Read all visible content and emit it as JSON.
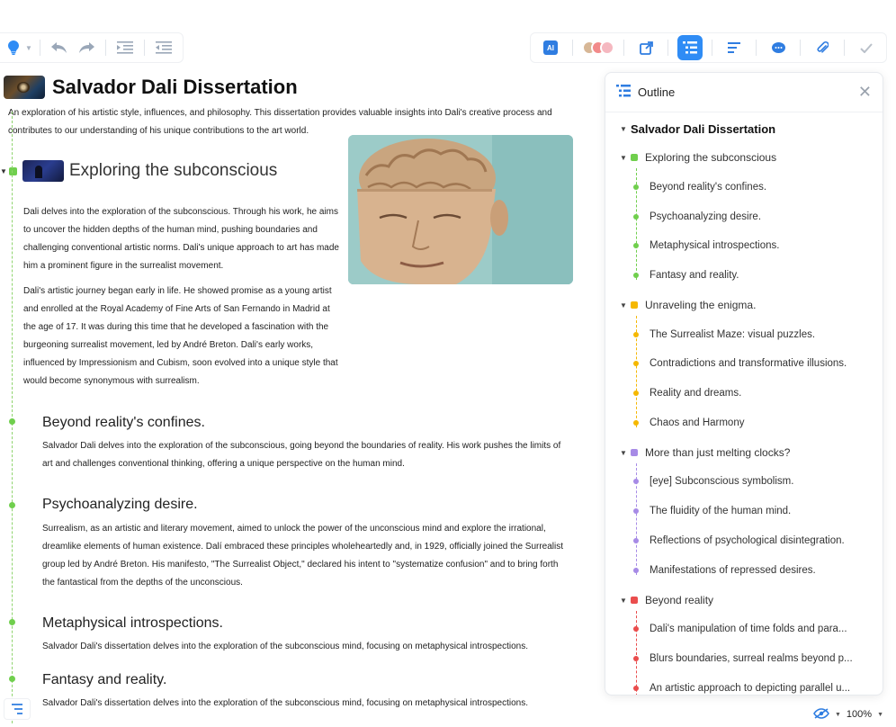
{
  "toolbar_left": {
    "icons": [
      "lightbulb-icon",
      "undo-icon",
      "redo-icon",
      "indent-icon",
      "outdent-icon"
    ]
  },
  "toolbar_right": {
    "ai_label": "AI",
    "icons": [
      "ai-icon",
      "collaborators-avatars",
      "share-icon",
      "outline-icon",
      "text-format-icon",
      "comment-icon",
      "attachment-icon",
      "check-icon"
    ]
  },
  "document": {
    "title": "Salvador Dali Dissertation",
    "description": "An exploration of his artistic style, influences, and philosophy. This dissertation provides valuable insights into Dali's creative process and contributes to our understanding of his unique contributions to the art world.",
    "topic": {
      "title": "Exploring the subconscious",
      "paragraphs": [
        "Dali delves into the exploration of the subconscious. Through his work, he aims to uncover the hidden depths of the human mind, pushing boundaries and challenging conventional artistic norms. Dali's unique approach to art has made him a prominent figure in the surrealist movement.",
        "Dali's artistic journey began early in life. He showed promise as a young artist and enrolled at the Royal Academy of Fine Arts of San Fernando in Madrid at the age of 17. It was during this time that he developed a fascination with the burgeoning surrealist movement, led by André Breton. Dali's early works, influenced by Impressionism and Cubism, soon evolved into a unique style that would become synonymous with surrealism."
      ]
    },
    "subsections": [
      {
        "title": "Beyond reality's confines.",
        "text": "Salvador Dali delves into the exploration of the subconscious, going beyond the boundaries of reality. His work pushes the limits of art and challenges conventional thinking, offering a unique perspective on the human mind."
      },
      {
        "title": "Psychoanalyzing desire.",
        "text": "Surrealism, as an artistic and literary movement, aimed to unlock the power of the unconscious mind and explore the irrational, dreamlike elements of human existence. Dalí embraced these principles wholeheartedly and, in 1929, officially joined the Surrealist group led by André Breton. His manifesto, \"The Surrealist Object,\" declared his intent to \"systematize confusion\" and to bring forth the fantastical from the depths of the unconscious."
      },
      {
        "title": "Metaphysical introspections.",
        "text": "Salvador Dali's dissertation delves into the exploration of the subconscious mind, focusing on metaphysical introspections."
      },
      {
        "title": "Fantasy and reality.",
        "text": "Salvador Dali's dissertation delves into the exploration of the subconscious mind, focusing on metaphysical introspections."
      }
    ]
  },
  "outline": {
    "title": "Outline",
    "root": "Salvador Dali Dissertation",
    "sections": [
      {
        "label": "Exploring the subconscious",
        "color": "#70cf4d",
        "items": [
          "Beyond reality's confines.",
          "Psychoanalyzing desire.",
          "Metaphysical introspections.",
          "Fantasy and reality."
        ]
      },
      {
        "label": "Unraveling the enigma.",
        "color": "#f5b800",
        "items": [
          "The Surrealist Maze: visual puzzles.",
          "Contradictions and transformative illusions.",
          "Reality and dreams.",
          "Chaos and Harmony"
        ]
      },
      {
        "label": "More than just melting clocks?",
        "color": "#a78be6",
        "items": [
          "[eye] Subconscious symbolism.",
          "The fluidity of the human mind.",
          "Reflections of psychological disintegration.",
          "Manifestations of repressed desires."
        ]
      },
      {
        "label": "Beyond reality",
        "color": "#ea4d4d",
        "items": [
          "Dali's manipulation of time folds and para...",
          "Blurs boundaries, surreal realms beyond p...",
          "An artistic approach to depicting parallel u..."
        ]
      }
    ]
  },
  "footer": {
    "zoom": "100%"
  }
}
